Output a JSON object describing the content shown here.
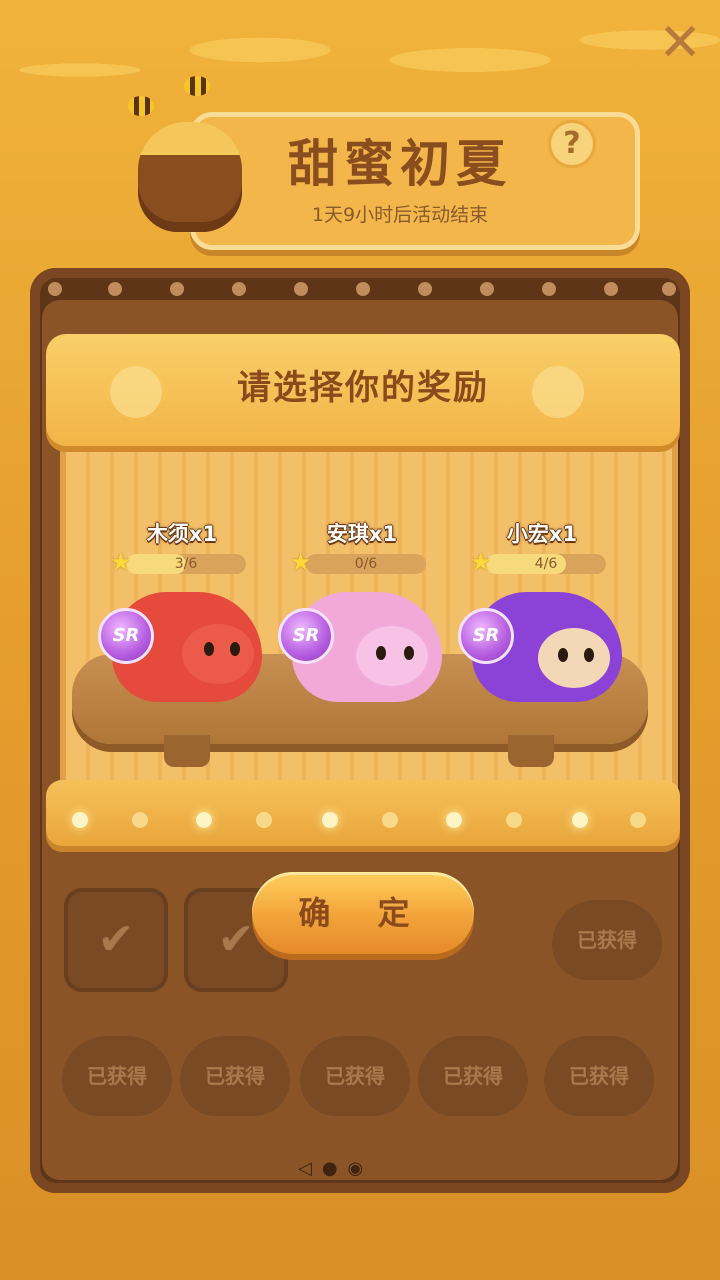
{
  "header": {
    "title": "甜蜜初夏",
    "countdown": "1天9小时后活动结束",
    "help_label": "?",
    "close_label": "✕"
  },
  "modal": {
    "title": "请选择你的奖励",
    "confirm_label": "确 定",
    "rewards": [
      {
        "name": "木须x1",
        "progress": "3/6",
        "progress_fraction": 0.5,
        "rarity": "SR",
        "color": "#e64a3c"
      },
      {
        "name": "安琪x1",
        "progress": "0/6",
        "progress_fraction": 0.0,
        "rarity": "SR",
        "color": "#f2a9d8"
      },
      {
        "name": "小宏x1",
        "progress": "4/6",
        "progress_fraction": 0.667,
        "rarity": "SR",
        "color": "#8b42d6"
      }
    ]
  },
  "background": {
    "obtained_label": "已获得",
    "pager": {
      "prev": "◁",
      "dots": "●◉"
    }
  }
}
